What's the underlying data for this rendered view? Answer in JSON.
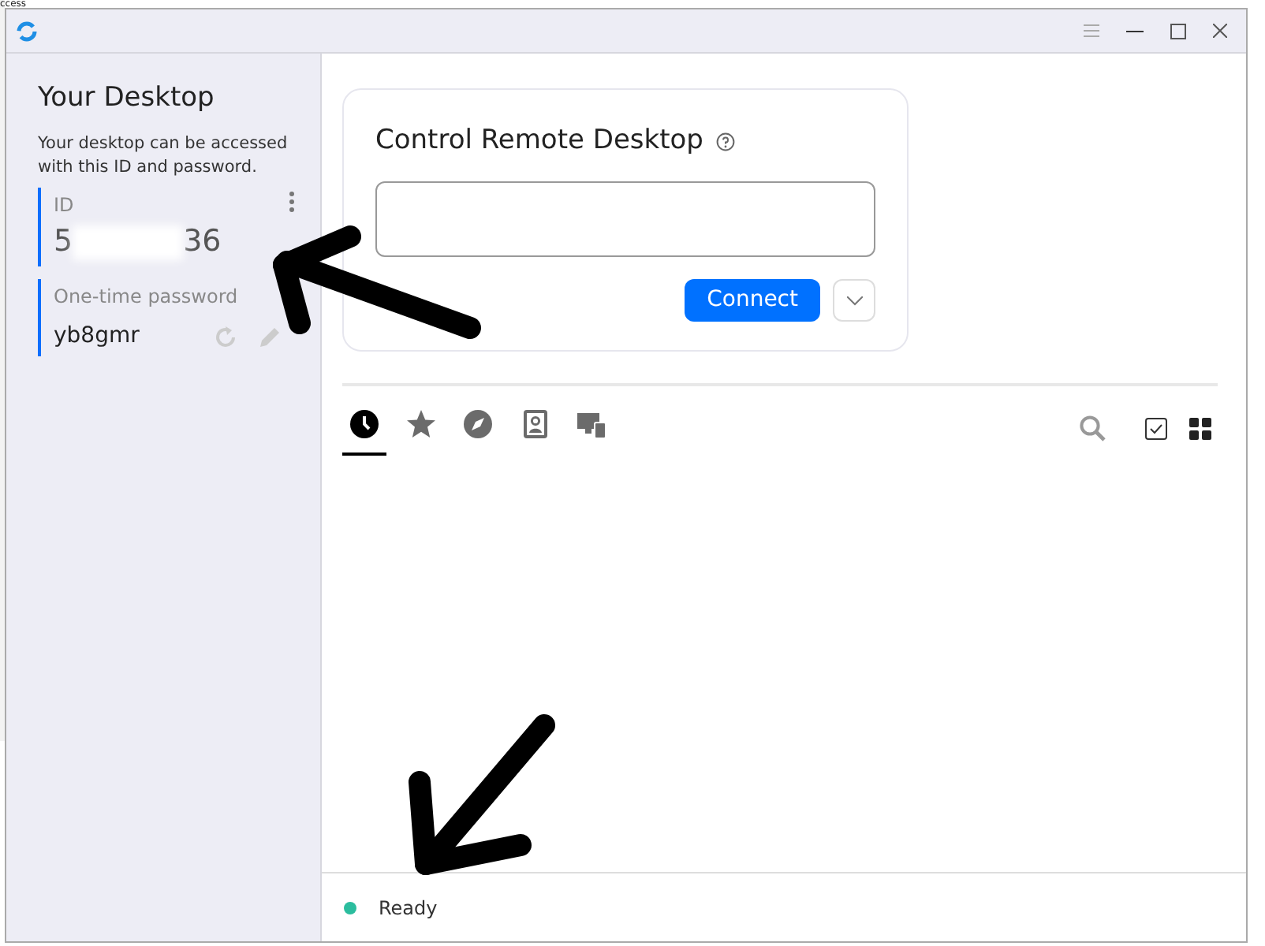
{
  "background_window": {
    "text": "ccess"
  },
  "sidebar": {
    "title": "Your Desktop",
    "description": "Your desktop can be accessed with this ID and password.",
    "id": {
      "label": "ID",
      "value_start": "5",
      "value_end": "36"
    },
    "password": {
      "label": "One-time password",
      "value": "yb8gmr"
    }
  },
  "connect_card": {
    "title": "Control Remote Desktop",
    "button": "Connect"
  },
  "tabs": [
    {
      "kind": "recent",
      "selected": true
    },
    {
      "kind": "favorites",
      "selected": false
    },
    {
      "kind": "discovered",
      "selected": false
    },
    {
      "kind": "address-book",
      "selected": false
    },
    {
      "kind": "devices",
      "selected": false
    }
  ],
  "status_bar": {
    "text": "Ready"
  }
}
